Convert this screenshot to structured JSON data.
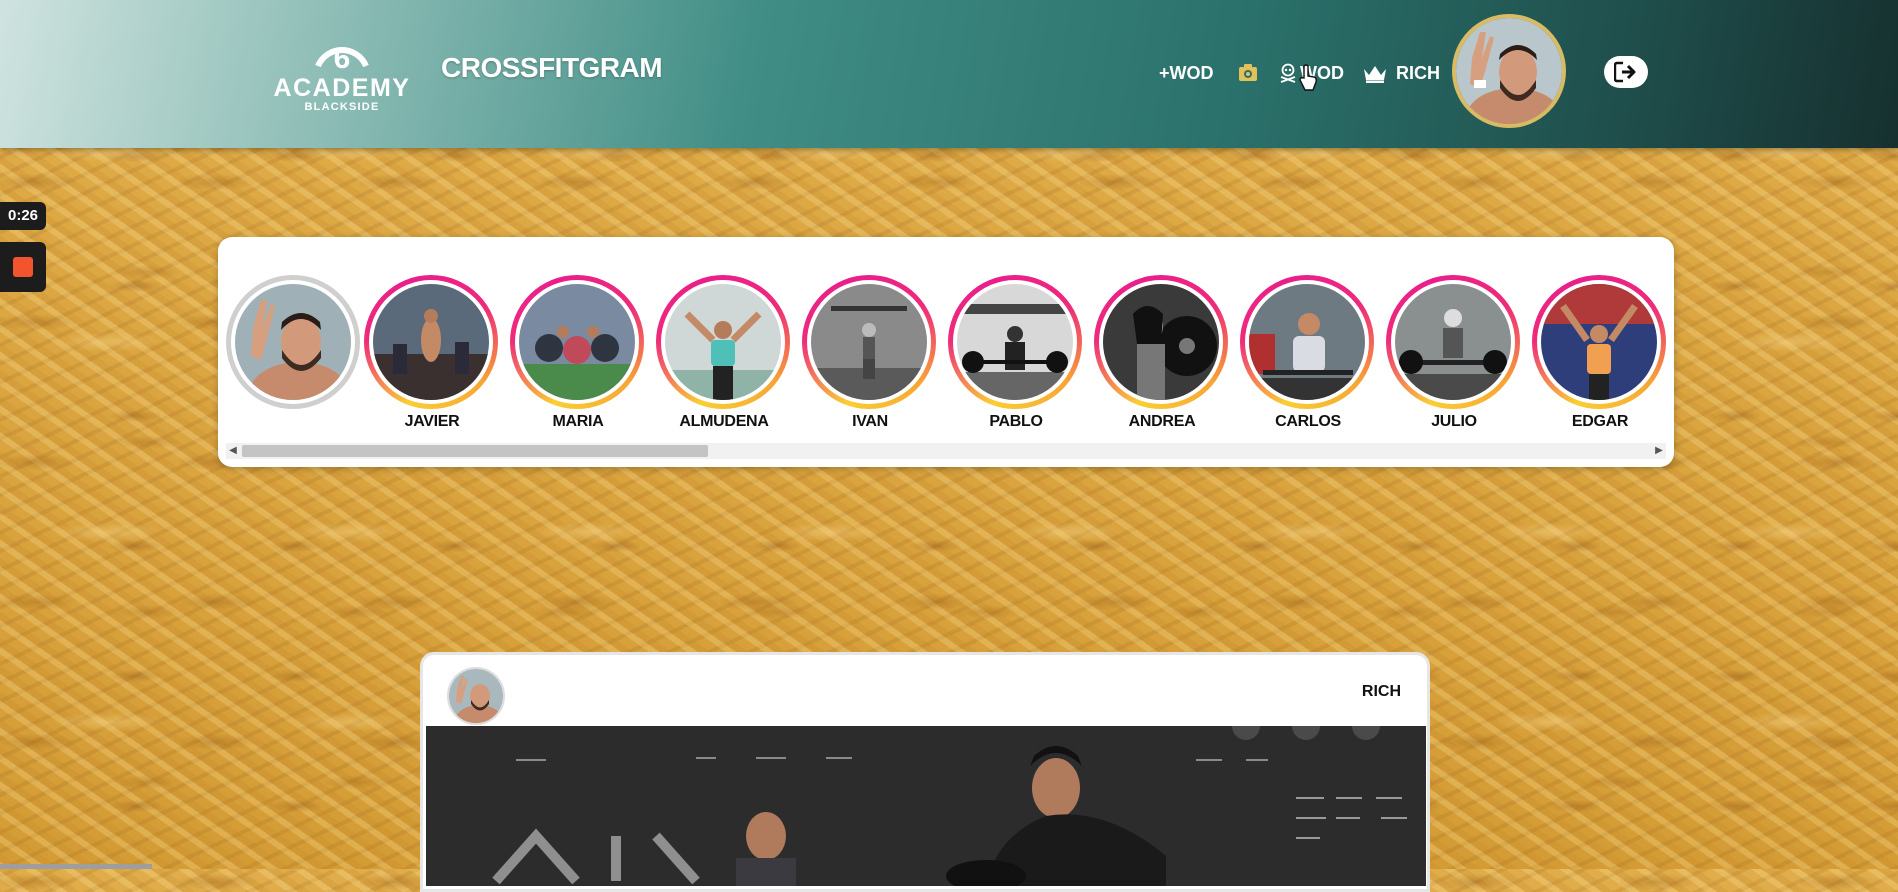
{
  "header": {
    "logo": {
      "main": "ACADEMY",
      "sub": "BLACKSIDE"
    },
    "brand": "CROSSFITGRAM",
    "nav": {
      "add_wod": "+WOD",
      "wod": "WOD",
      "rich": "RICH"
    },
    "icons": [
      "plus-icon",
      "camera-icon",
      "skull-icon",
      "crown-icon",
      "logout-icon"
    ]
  },
  "recorder": {
    "time": "0:26"
  },
  "stories": {
    "items": [
      {
        "label": "",
        "own": true
      },
      {
        "label": "JAVIER"
      },
      {
        "label": "MARIA"
      },
      {
        "label": "ALMUDENA"
      },
      {
        "label": "IVAN"
      },
      {
        "label": "PABLO"
      },
      {
        "label": "ANDREA"
      },
      {
        "label": "CARLOS"
      },
      {
        "label": "JULIO"
      },
      {
        "label": "EDGAR"
      }
    ]
  },
  "post": {
    "username": "RICH"
  },
  "colors": {
    "header_dark": "#1f4f4c",
    "header_light": "#cfe3df",
    "profile_ring": "#d8bb63",
    "story_ring_pink": "#ee2a7b",
    "story_ring_yellow": "#f9ce34",
    "record_red": "#f2542d"
  }
}
